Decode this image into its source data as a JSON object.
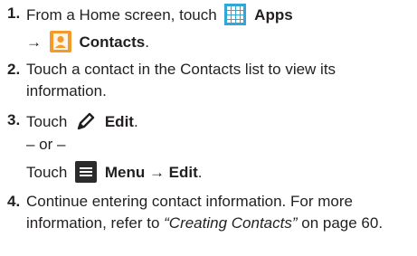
{
  "steps": [
    {
      "number": "1.",
      "lines": [
        {
          "pre": "From a Home screen, touch",
          "bold": "Apps"
        },
        {
          "arrow": "→",
          "bold": "Contacts",
          "suffix": "."
        }
      ]
    },
    {
      "number": "2.",
      "lines": [
        {
          "text": "Touch a contact in the Contacts list to view its"
        },
        {
          "text": "information."
        }
      ]
    },
    {
      "number": "3.",
      "lines": [
        {
          "pre": "Touch",
          "bold": "Edit",
          "suffix": "."
        },
        {
          "text": "– or –"
        },
        {
          "pre": "Touch",
          "bold": "Menu → Edit",
          "suffix": "."
        }
      ]
    },
    {
      "number": "4.",
      "lines": [
        {
          "text": "Continue entering contact information. For more"
        },
        {
          "pre": "information, refer to ",
          "italic": "“Creating Contacts”",
          "suffix": " on page 60."
        }
      ]
    }
  ],
  "icons": {
    "apps": "apps-grid-icon",
    "contacts": "contacts-icon",
    "edit": "edit-pencil-icon",
    "menu": "menu-icon"
  },
  "colors": {
    "text": "#231f20",
    "apps_grid": "#2fa8d8",
    "contacts_bg": "#f49a2a",
    "menu_bg": "#2b2b2b"
  }
}
